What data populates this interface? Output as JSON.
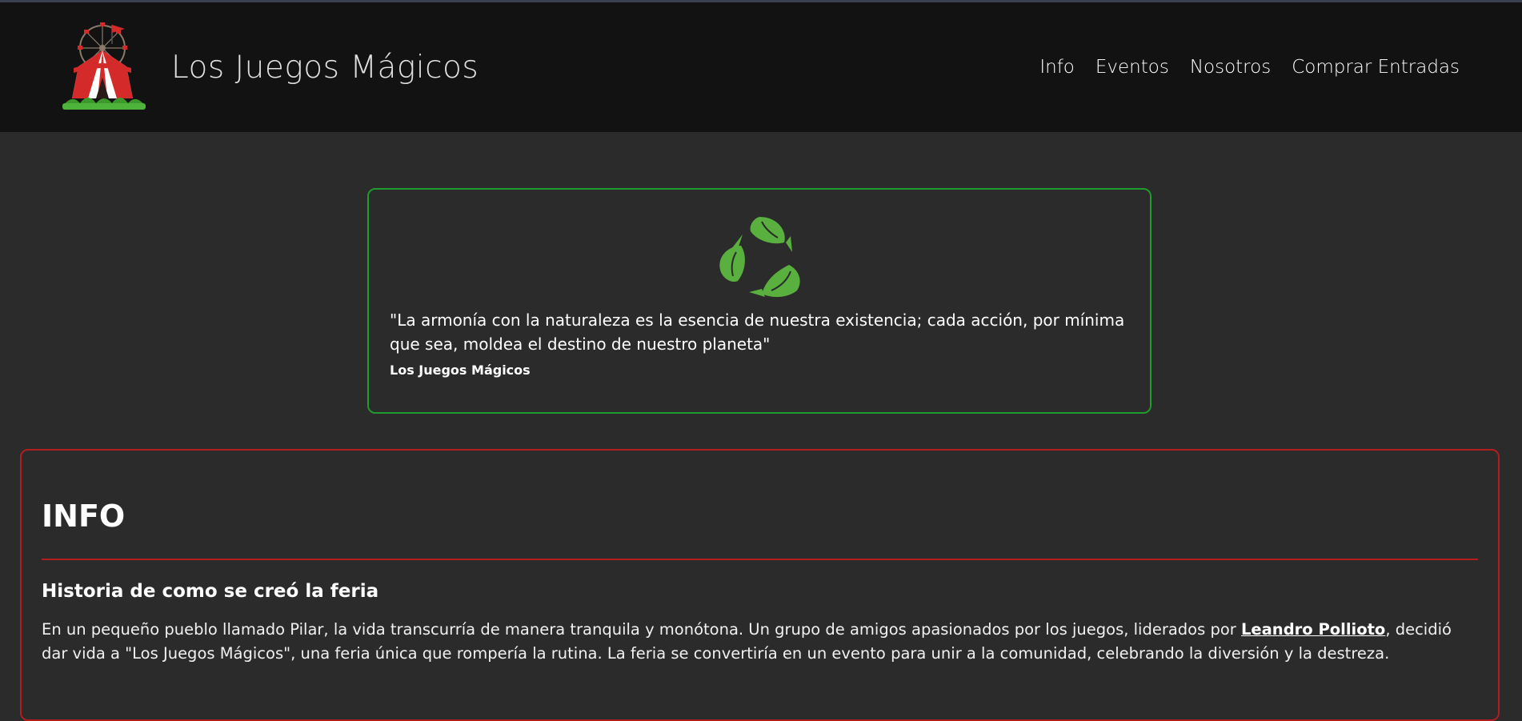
{
  "header": {
    "site_title": "Los Juegos Mágicos",
    "nav": [
      {
        "label": "Info"
      },
      {
        "label": "Eventos"
      },
      {
        "label": "Nosotros"
      },
      {
        "label": "Comprar Entradas"
      }
    ],
    "logo_icon": "circus-tent-ferris-wheel-logo"
  },
  "quote": {
    "icon": "recycle-leaves-icon",
    "text": "\"La armonía con la naturaleza es la esencia de nuestra existencia; cada acción, por mínima que sea, moldea el destino de nuestro planeta\"",
    "author": "Los Juegos Mágicos",
    "border_color": "#1f9a2e",
    "icon_color": "#5ab03e"
  },
  "info": {
    "title": "INFO",
    "subtitle": "Historia de como se creó la feria",
    "paragraph_before": "En un pequeño pueblo llamado Pilar, la vida transcurría de manera tranquila y monótona. Un grupo de amigos apasionados por los juegos, liderados por ",
    "paragraph_link": "Leandro Pollioto",
    "paragraph_after": ", decidió dar vida a \"Los Juegos Mágicos\", una feria única que rompería la rutina. La feria se convertiría en un evento para unir a la comunidad, celebrando la diversión y la destreza.",
    "border_color": "#b01e1e"
  }
}
